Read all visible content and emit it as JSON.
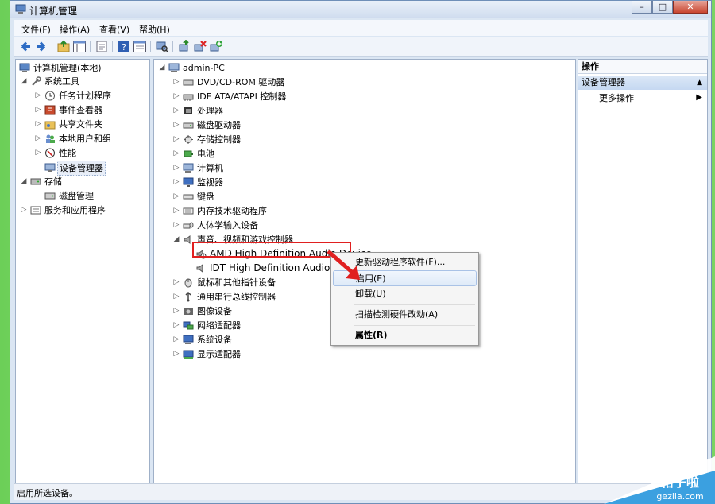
{
  "window": {
    "title": "计算机管理"
  },
  "menu": [
    "文件(F)",
    "操作(A)",
    "查看(V)",
    "帮助(H)"
  ],
  "left_tree": {
    "root": "计算机管理(本地)",
    "items": [
      {
        "label": "系统工具"
      },
      {
        "label": "任务计划程序"
      },
      {
        "label": "事件查看器"
      },
      {
        "label": "共享文件夹"
      },
      {
        "label": "本地用户和组"
      },
      {
        "label": "性能"
      },
      {
        "label": "设备管理器"
      },
      {
        "label": "存储"
      },
      {
        "label": "磁盘管理"
      },
      {
        "label": "服务和应用程序"
      }
    ]
  },
  "device_tree": {
    "root": "admin-PC",
    "categories": [
      "DVD/CD-ROM 驱动器",
      "IDE ATA/ATAPI 控制器",
      "处理器",
      "磁盘驱动器",
      "存储控制器",
      "电池",
      "计算机",
      "监视器",
      "键盘",
      "内存技术驱动程序",
      "人体学输入设备",
      "声音、视频和游戏控制器",
      "AMD High Definition Audio Device",
      "IDT High Definition Audio CO",
      "鼠标和其他指针设备",
      "通用串行总线控制器",
      "图像设备",
      "网络适配器",
      "系统设备",
      "显示适配器"
    ]
  },
  "actions": {
    "header": "操作",
    "section": "设备管理器",
    "more": "更多操作"
  },
  "context_menu": {
    "items": [
      "更新驱动程序软件(F)...",
      "启用(E)",
      "卸载(U)",
      "扫描检测硬件改动(A)",
      "属性(R)"
    ]
  },
  "status": {
    "text": "启用所选设备。"
  },
  "watermark": {
    "line1": "格子啦",
    "line2": "gezila.com"
  },
  "colors": {
    "highlight_box": "#e02020",
    "arrow": "#e02020"
  }
}
